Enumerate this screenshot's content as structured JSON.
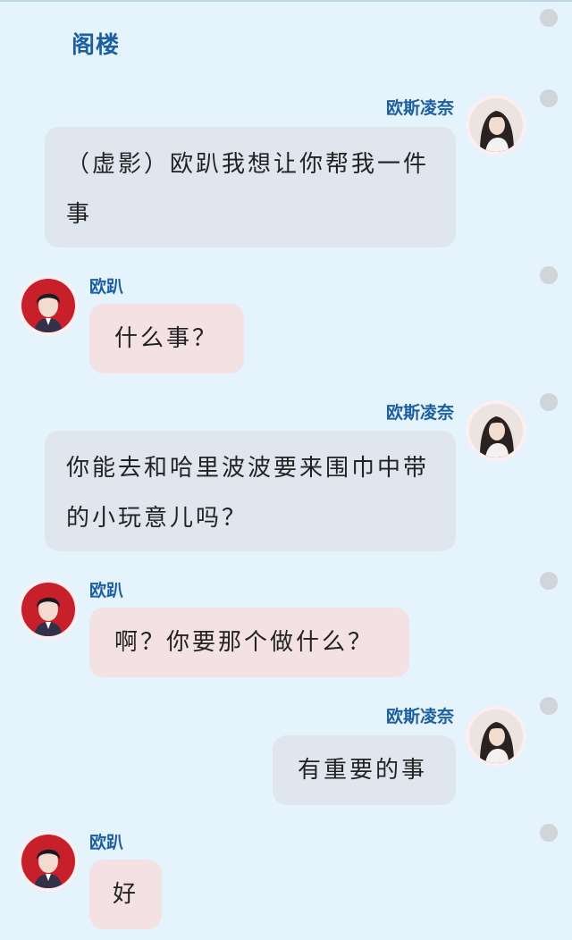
{
  "header": {
    "title": "阁楼"
  },
  "messages": [
    {
      "sender": "欧斯凌奈",
      "side": "right",
      "text": "（虚影）欧趴我想让你帮我一件事"
    },
    {
      "sender": "欧趴",
      "side": "left",
      "text": "什么事？"
    },
    {
      "sender": "欧斯凌奈",
      "side": "right",
      "text": "你能去和哈里波波要来围巾中带的小玩意儿吗？"
    },
    {
      "sender": "欧趴",
      "side": "left",
      "text": "啊？你要那个做什么？"
    },
    {
      "sender": "欧斯凌奈",
      "side": "right",
      "text": "有重要的事"
    },
    {
      "sender": "欧趴",
      "side": "left",
      "text": "好"
    }
  ],
  "colors": {
    "background": "#e4f3fc",
    "name_text": "#1d5f9e",
    "right_bubble": "#dfe6ed",
    "left_bubble": "#f3e1e3",
    "rail_dot": "#d0d5da"
  }
}
